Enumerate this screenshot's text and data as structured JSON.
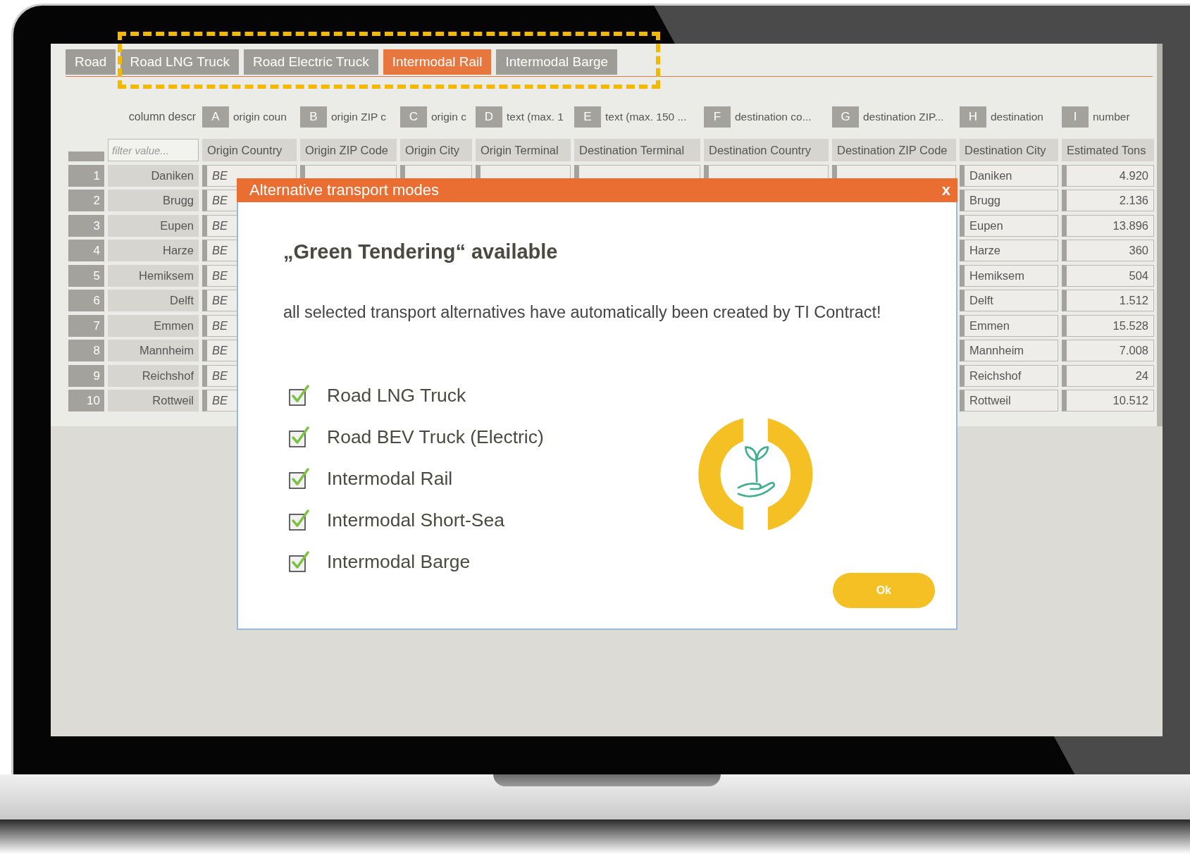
{
  "tabs": [
    {
      "label": "Road",
      "selected": false
    },
    {
      "label": "Road LNG Truck",
      "selected": false
    },
    {
      "label": "Road Electric Truck",
      "selected": false
    },
    {
      "label": "Intermodal Rail",
      "selected": true
    },
    {
      "label": "Intermodal Barge",
      "selected": false
    }
  ],
  "column_descriptions": {
    "label": "column descr",
    "items": [
      {
        "letter": "A",
        "text": "origin coun"
      },
      {
        "letter": "B",
        "text": "origin ZIP c"
      },
      {
        "letter": "C",
        "text": "origin c"
      },
      {
        "letter": "D",
        "text": "text (max. 1"
      },
      {
        "letter": "E",
        "text": "text (max. 150 ..."
      },
      {
        "letter": "F",
        "text": "destination co..."
      },
      {
        "letter": "G",
        "text": "destination ZIP..."
      },
      {
        "letter": "H",
        "text": "destination"
      },
      {
        "letter": "I",
        "text": "number"
      }
    ]
  },
  "table": {
    "filter": {
      "placeholder": "filter value..."
    },
    "columns": [
      "Origin Country",
      "Origin ZIP Code",
      "Origin City",
      "Origin Terminal",
      "Destination Terminal",
      "Destination Country",
      "Destination ZIP Code",
      "Destination City",
      "Estimated Tons"
    ],
    "rows": [
      {
        "number": "1",
        "city": "Daniken",
        "origin_country": "BE",
        "destination_city": "Daniken",
        "estimated_tons": "4.920"
      },
      {
        "number": "2",
        "city": "Brugg",
        "origin_country": "BE",
        "destination_city": "Brugg",
        "estimated_tons": "2.136"
      },
      {
        "number": "3",
        "city": "Eupen",
        "origin_country": "BE",
        "destination_city": "Eupen",
        "estimated_tons": "13.896"
      },
      {
        "number": "4",
        "city": "Harze",
        "origin_country": "BE",
        "destination_city": "Harze",
        "estimated_tons": "360"
      },
      {
        "number": "5",
        "city": "Hemiksem",
        "origin_country": "BE",
        "destination_city": "Hemiksem",
        "estimated_tons": "504"
      },
      {
        "number": "6",
        "city": "Delft",
        "origin_country": "BE",
        "destination_city": "Delft",
        "estimated_tons": "1.512"
      },
      {
        "number": "7",
        "city": "Emmen",
        "origin_country": "BE",
        "destination_city": "Emmen",
        "estimated_tons": "15.528"
      },
      {
        "number": "8",
        "city": "Mannheim",
        "origin_country": "BE",
        "destination_city": "Mannheim",
        "estimated_tons": "7.008"
      },
      {
        "number": "9",
        "city": "Reichshof",
        "origin_country": "BE",
        "destination_city": "Reichshof",
        "estimated_tons": "24"
      },
      {
        "number": "10",
        "city": "Rottweil",
        "origin_country": "BE",
        "destination_city": "Rottweil",
        "estimated_tons": "10.512"
      }
    ]
  },
  "dialog": {
    "title": "Alternative transport modes",
    "close": "x",
    "heading": "„Green Tendering“ available",
    "message": "all selected transport alternatives have automatically been created by TI Contract!",
    "options": [
      {
        "label": "Road LNG Truck",
        "checked": true
      },
      {
        "label": "Road BEV Truck (Electric)",
        "checked": true
      },
      {
        "label": "Intermodal Rail",
        "checked": true
      },
      {
        "label": "Intermodal Short-Sea",
        "checked": true
      },
      {
        "label": "Intermodal Barge",
        "checked": true
      }
    ],
    "button": "Ok"
  }
}
